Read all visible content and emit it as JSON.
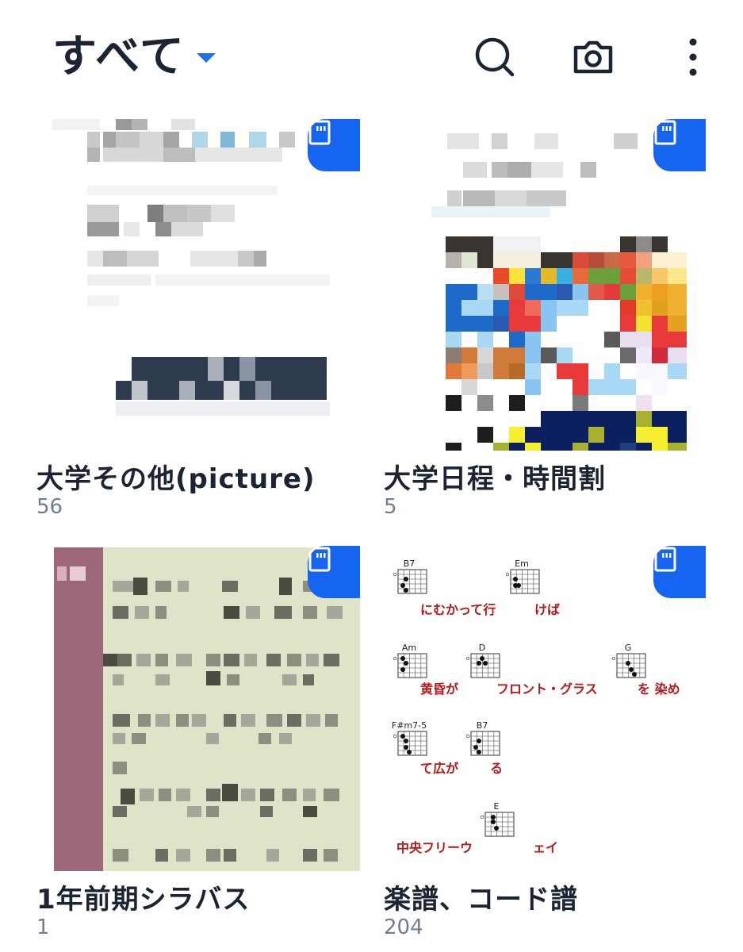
{
  "header": {
    "filter_label": "すべて",
    "icons": {
      "dropdown": "chevron-down-icon",
      "search": "search-icon",
      "camera": "camera-icon",
      "more": "more-vertical-icon"
    }
  },
  "colors": {
    "accent": "#1a73e8",
    "badge": "#1565f0",
    "title_text": "#1b2432",
    "count_text": "#707d8f",
    "lyrics_red": "#b8181a"
  },
  "albums": [
    {
      "title": "大学その他(picture)",
      "count": "56",
      "badge_icon": "sd-card-icon"
    },
    {
      "title": "大学日程・時間割",
      "count": "5",
      "badge_icon": "sd-card-icon"
    },
    {
      "title": "1年前期シラバス",
      "count": "1",
      "badge_icon": "sd-card-icon"
    },
    {
      "title": "楽譜、コード譜",
      "count": "204",
      "badge_icon": "sd-card-icon"
    }
  ],
  "chord_sheet": {
    "chords": [
      "B7",
      "Em",
      "Am",
      "D",
      "G",
      "F#m7-5",
      "B7",
      "E"
    ],
    "lyrics": [
      "にむかって行",
      "けば",
      "黄昏が",
      "フロント・グラス",
      "を 染め",
      "て広が",
      "る",
      "中央フリーウ",
      "ェイ"
    ]
  }
}
